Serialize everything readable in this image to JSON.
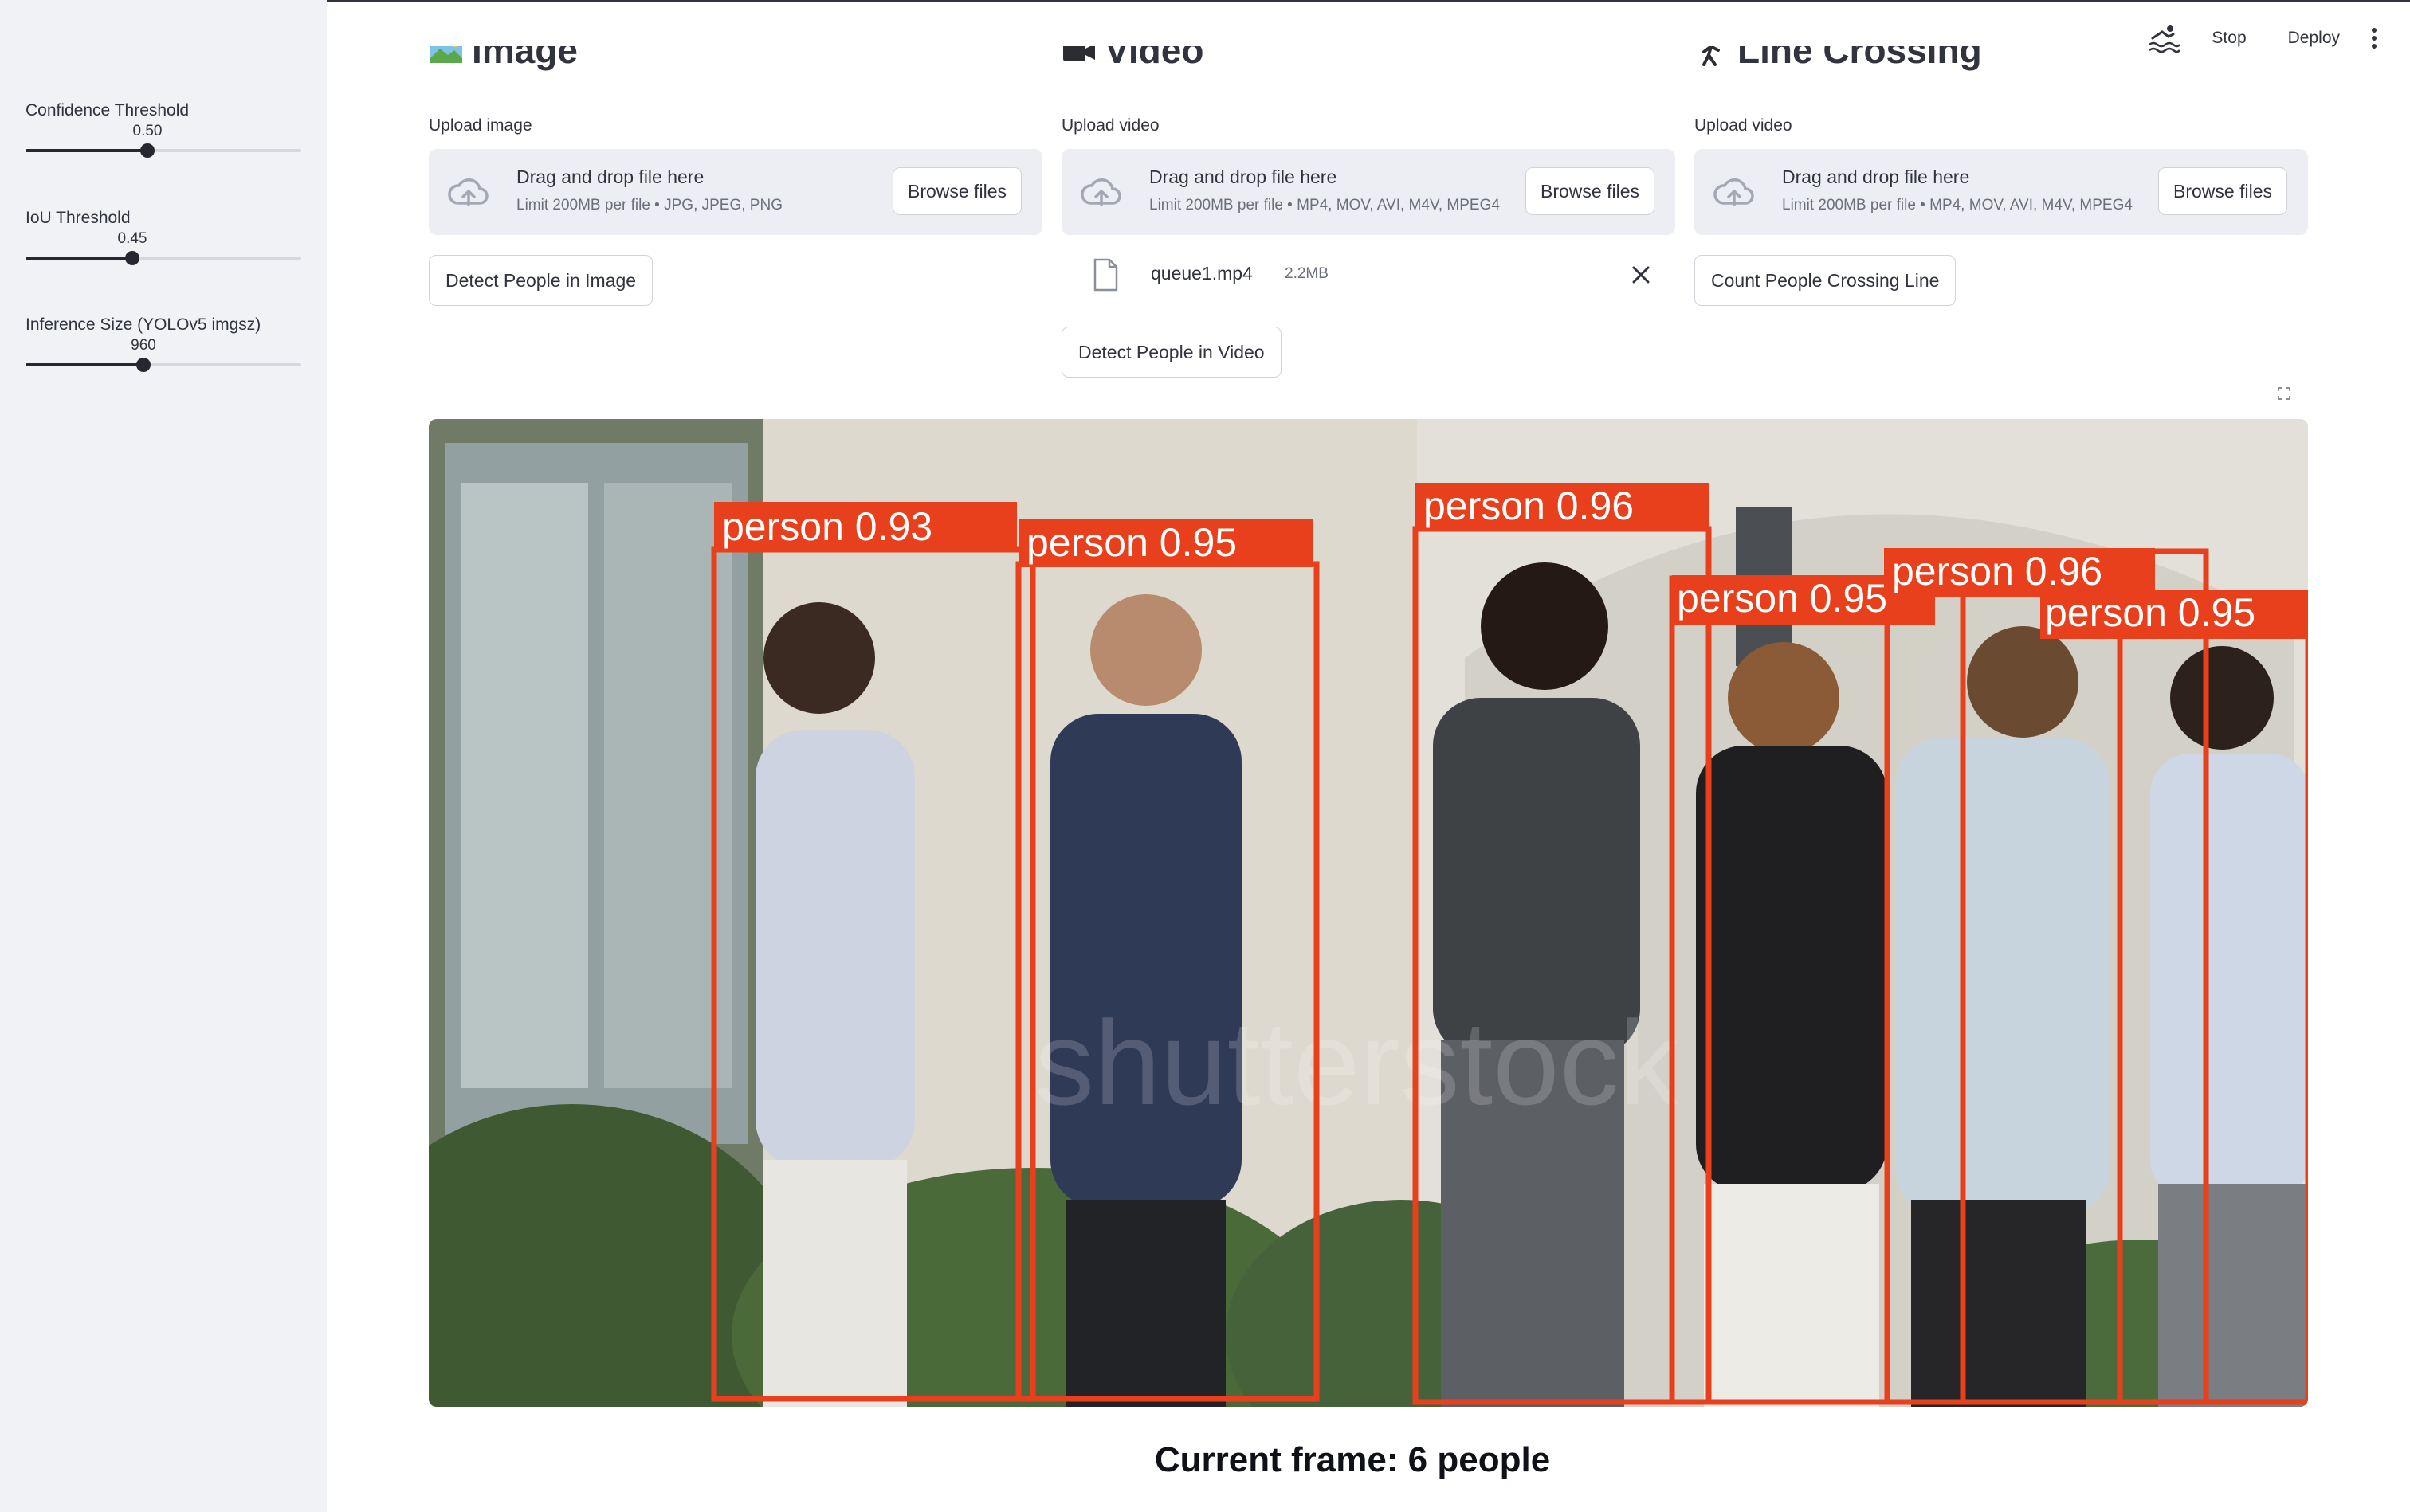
{
  "sidebar": {
    "sliders": [
      {
        "label": "Confidence Threshold",
        "value": "0.50",
        "fraction": 0.5
      },
      {
        "label": "IoU Threshold",
        "value": "0.45",
        "fraction": 0.45
      },
      {
        "label": "Inference Size (YOLOv5 imgsz)",
        "value": "960",
        "fraction": 0.43
      }
    ]
  },
  "header": {
    "stop_label": "Stop",
    "deploy_label": "Deploy",
    "running_icon": "swimmer-icon",
    "menu_icon": "kebab-menu-icon"
  },
  "columns": {
    "image": {
      "title": "Image",
      "upload_label": "Upload image",
      "drop_title": "Drag and drop file here",
      "drop_limit": "Limit 200MB per file • JPG, JPEG, PNG",
      "browse_label": "Browse files",
      "action_label": "Detect People in Image"
    },
    "video": {
      "title": "Video",
      "upload_label": "Upload video",
      "drop_title": "Drag and drop file here",
      "drop_limit": "Limit 200MB per file • MP4, MOV, AVI, M4V, MPEG4",
      "browse_label": "Browse files",
      "file_name": "queue1.mp4",
      "file_size": "2.2MB",
      "action_label": "Detect People in Video"
    },
    "line": {
      "title": "Line Crossing",
      "upload_label": "Upload video",
      "drop_title": "Drag and drop file here",
      "drop_limit": "Limit 200MB per file • MP4, MOV, AVI, M4V, MPEG4",
      "browse_label": "Browse files",
      "action_label": "Count People Crossing Line"
    }
  },
  "detections": [
    {
      "label": "person 0.93"
    },
    {
      "label": "person 0.95"
    },
    {
      "label": "person 0.96"
    },
    {
      "label": "person 0.95"
    },
    {
      "label": "person 0.96"
    },
    {
      "label": "person 0.95"
    }
  ],
  "frame_watermark": "shutterstock",
  "caption": "Current frame: 6 people",
  "colors": {
    "sidebar_bg": "#f0f2f6",
    "dropzone_bg": "#eceef3",
    "box_color": "#e8401c",
    "text": "#31333f"
  }
}
